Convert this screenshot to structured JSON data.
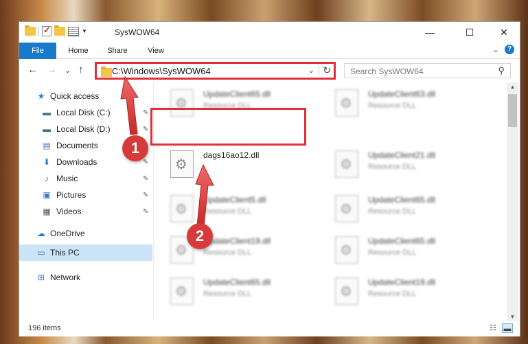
{
  "window": {
    "title": "SysWOW64",
    "controls": {
      "minimize": "—",
      "maximize": "☐",
      "close": "✕"
    }
  },
  "ribbon": {
    "tabs": [
      {
        "label": "File"
      },
      {
        "label": "Home"
      },
      {
        "label": "Share"
      },
      {
        "label": "View"
      }
    ],
    "expand_glyph": "⌄",
    "help_glyph": "?"
  },
  "address_bar": {
    "path": "C:\\Windows\\SysWOW64",
    "dropdown_glyph": "⌄",
    "refresh_glyph": "↻"
  },
  "search": {
    "placeholder": "Search SysWOW64",
    "icon_glyph": "⚲"
  },
  "nav_buttons": {
    "back": "←",
    "forward": "→",
    "recent": "⌄",
    "up": "↑"
  },
  "navigation_pane": {
    "items": [
      {
        "label": "Quick access",
        "icon": "star-icon",
        "glyph": "★",
        "pinned": false
      },
      {
        "label": "Local Disk (C:)",
        "icon": "drive-icon",
        "glyph": "▬",
        "pinned": true
      },
      {
        "label": "Local Disk (D:)",
        "icon": "drive-icon",
        "glyph": "▬",
        "pinned": true
      },
      {
        "label": "Documents",
        "icon": "documents-icon",
        "glyph": "▤",
        "pinned": true
      },
      {
        "label": "Downloads",
        "icon": "downloads-icon",
        "glyph": "⬇",
        "pinned": true
      },
      {
        "label": "Music",
        "icon": "music-icon",
        "glyph": "♪",
        "pinned": true
      },
      {
        "label": "Pictures",
        "icon": "pictures-icon",
        "glyph": "▣",
        "pinned": true
      },
      {
        "label": "Videos",
        "icon": "videos-icon",
        "glyph": "▦",
        "pinned": true
      },
      {
        "label": "OneDrive",
        "icon": "cloud-icon",
        "glyph": "☁",
        "pinned": false
      },
      {
        "label": "This PC",
        "icon": "computer-icon",
        "glyph": "▭",
        "pinned": false,
        "selected": true
      },
      {
        "label": "Network",
        "icon": "network-icon",
        "glyph": "⊞",
        "pinned": false
      }
    ],
    "pin_glyph": "✎"
  },
  "files": {
    "left_column": [
      {
        "name": "UpdateClient65.dll",
        "type": "Resource DLL"
      },
      {
        "name": "dags16ao12.dll",
        "type": "",
        "highlighted": true
      },
      {
        "name": "UpdateClient5.dll",
        "type": "Resource DLL"
      },
      {
        "name": "UpdateClient19.dll",
        "type": "Resource DLL"
      },
      {
        "name": "UpdateClient65.dll",
        "type": "Resource DLL"
      }
    ],
    "right_column": [
      {
        "name": "UpdateClient63.dll",
        "type": "Resource DLL"
      },
      {
        "name": "UpdateClient21.dll",
        "type": "Resource DLL"
      },
      {
        "name": "UpdateClient65.dll",
        "type": "Resource DLL"
      },
      {
        "name": "UpdateClient65.dll",
        "type": "Resource DLL"
      },
      {
        "name": "UpdateClient19.dll",
        "type": "Resource DLL"
      }
    ],
    "file_icon_glyph": "⚙"
  },
  "status_bar": {
    "item_count": "196 items",
    "details_view_glyph": "☷",
    "tiles_view_glyph": "▬"
  },
  "annotations": [
    {
      "number": "1"
    },
    {
      "number": "2"
    }
  ],
  "colors": {
    "accent": "#1979ca",
    "highlight_red": "#e0303a",
    "callout_red": "#d73a3a",
    "selection": "#cce4f7"
  }
}
